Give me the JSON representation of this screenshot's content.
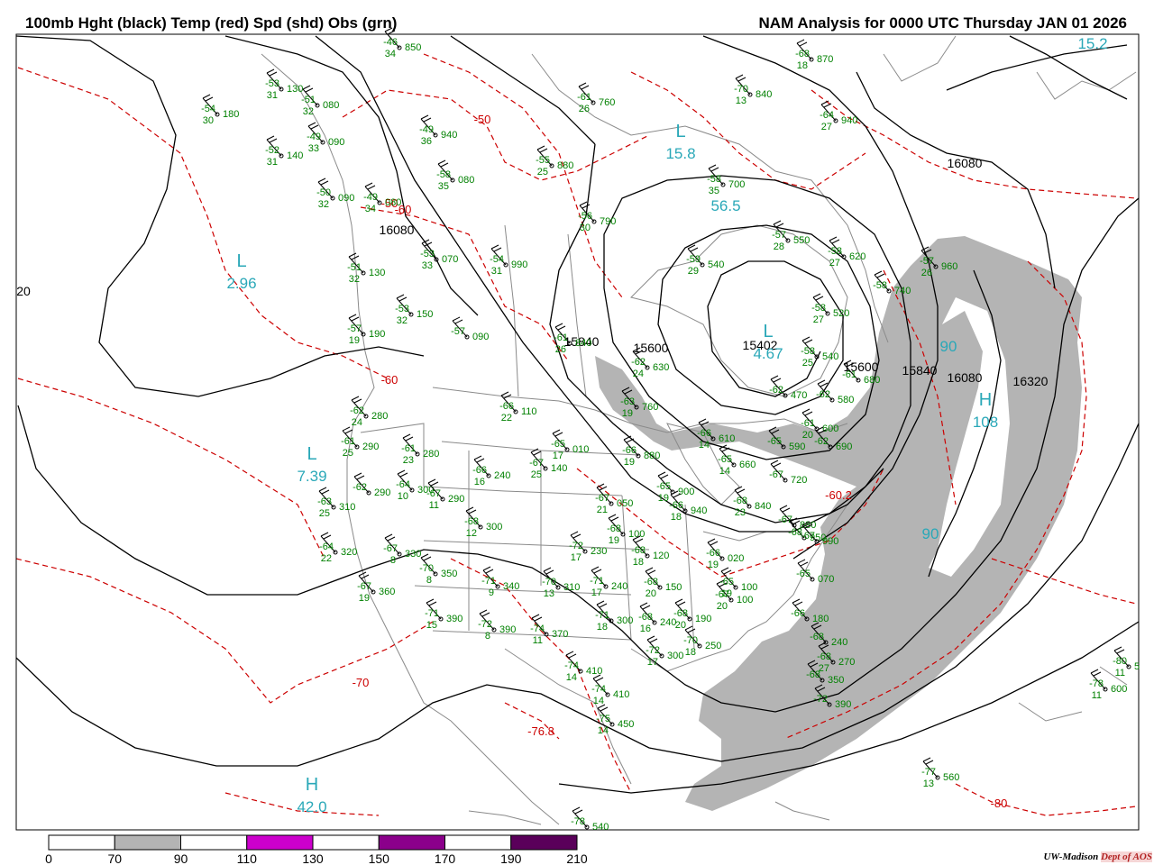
{
  "header": {
    "left_title": "100mb Hght (black) Temp (red) Spd (shd) Obs (grn)",
    "right_title": "NAM Analysis for 0000 UTC Thursday  JAN 01 2026"
  },
  "credit": {
    "org": "UW-Madison",
    "dept": "Dept of AOS"
  },
  "colors": {
    "height_contours": "#000000",
    "temperature_contours": "#cc0000",
    "speed_shading_70_90": "#b4b4b4",
    "observations": "#008000",
    "centers": "#2aa8b8",
    "borders": "#888888"
  },
  "colorbar": {
    "ticks": [
      "0",
      "70",
      "90",
      "110",
      "130",
      "150",
      "170",
      "190",
      "210"
    ],
    "fills": [
      "#ffffff",
      "#b4b4b4",
      "#ffffff",
      "#cc00cc",
      "#ffffff",
      "#8b008b",
      "#ffffff",
      "#5a005a"
    ]
  },
  "centers": [
    {
      "letter": "L",
      "value": "2.96"
    },
    {
      "letter": "L",
      "value": "7.39"
    },
    {
      "letter": "H",
      "value": "42.0"
    },
    {
      "letter": "L",
      "value": "15.8"
    },
    {
      "letter": "",
      "value": "56.5"
    },
    {
      "letter": "L",
      "value": "4.67"
    },
    {
      "letter": "H",
      "value": "108"
    },
    {
      "letter": "",
      "value": "90"
    },
    {
      "letter": "",
      "value": "90"
    },
    {
      "letter": "",
      "value": "15.2"
    }
  ],
  "height_labels": [
    "16080",
    "16080",
    "16080",
    "15840",
    "15840",
    "15600",
    "15600",
    "15402",
    "16320",
    "20"
  ],
  "temp_labels": [
    "-50",
    "-60",
    "-60",
    "-70",
    "-76.8",
    "-80",
    "-60.2",
    "-50"
  ],
  "observations": [
    {
      "temp": "-46",
      "dew": "34",
      "hgt": "850"
    },
    {
      "temp": "-53",
      "dew": "31",
      "hgt": "130"
    },
    {
      "temp": "-51",
      "dew": "32",
      "hgt": "080"
    },
    {
      "temp": "-54",
      "dew": "30",
      "hgt": "180"
    },
    {
      "temp": "-49",
      "dew": "33",
      "hgt": "090"
    },
    {
      "temp": "-52",
      "dew": "31",
      "hgt": "140"
    },
    {
      "temp": "-49",
      "dew": "36",
      "hgt": "940"
    },
    {
      "temp": "-50",
      "dew": "32",
      "hgt": "090"
    },
    {
      "temp": "-49",
      "dew": "34",
      "hgt": "080"
    },
    {
      "temp": "-51",
      "dew": "32",
      "hgt": "130"
    },
    {
      "temp": "-53",
      "dew": "32",
      "hgt": "150"
    },
    {
      "temp": "-57",
      "dew": "",
      "hgt": "090"
    },
    {
      "temp": "-57",
      "dew": "19",
      "hgt": "190"
    },
    {
      "temp": "-62",
      "dew": "24",
      "hgt": "280"
    },
    {
      "temp": "-61",
      "dew": "25",
      "hgt": "290"
    },
    {
      "temp": "-61",
      "dew": "23",
      "hgt": "280"
    },
    {
      "temp": "-62",
      "dew": "",
      "hgt": "290"
    },
    {
      "temp": "-64",
      "dew": "10",
      "hgt": "300"
    },
    {
      "temp": "-63",
      "dew": "25",
      "hgt": "310"
    },
    {
      "temp": "-64",
      "dew": "22",
      "hgt": "320"
    },
    {
      "temp": "-67",
      "dew": "8",
      "hgt": "330"
    },
    {
      "temp": "-67",
      "dew": "19",
      "hgt": "360"
    },
    {
      "temp": "-70",
      "dew": "8",
      "hgt": "350"
    },
    {
      "temp": "-71",
      "dew": "15",
      "hgt": "390"
    },
    {
      "temp": "-66",
      "dew": "16",
      "hgt": "240"
    },
    {
      "temp": "-67",
      "dew": "11",
      "hgt": "290"
    },
    {
      "temp": "-68",
      "dew": "12",
      "hgt": "300"
    },
    {
      "temp": "-71",
      "dew": "9",
      "hgt": "340"
    },
    {
      "temp": "-70",
      "dew": "13",
      "hgt": "310"
    },
    {
      "temp": "-72",
      "dew": "8",
      "hgt": "390"
    },
    {
      "temp": "-74",
      "dew": "11",
      "hgt": "370"
    },
    {
      "temp": "-74",
      "dew": "14",
      "hgt": "410"
    },
    {
      "temp": "-74",
      "dew": "14",
      "hgt": "410"
    },
    {
      "temp": "-75",
      "dew": "14",
      "hgt": "450"
    },
    {
      "temp": "-78",
      "dew": "",
      "hgt": "540"
    },
    {
      "temp": "-72",
      "dew": "17",
      "hgt": "230"
    },
    {
      "temp": "-71",
      "dew": "17",
      "hgt": "240"
    },
    {
      "temp": "-71",
      "dew": "18",
      "hgt": "300"
    },
    {
      "temp": "-66",
      "dew": "22",
      "hgt": "110"
    },
    {
      "temp": "-67",
      "dew": "25",
      "hgt": "140"
    },
    {
      "temp": "-65",
      "dew": "17",
      "hgt": "010"
    },
    {
      "temp": "-67",
      "dew": "21",
      "hgt": "050"
    },
    {
      "temp": "-68",
      "dew": "19",
      "hgt": "100"
    },
    {
      "temp": "-68",
      "dew": "18",
      "hgt": "120"
    },
    {
      "temp": "-68",
      "dew": "20",
      "hgt": "150"
    },
    {
      "temp": "-68",
      "dew": "20",
      "hgt": "190"
    },
    {
      "temp": "-68",
      "dew": "16",
      "hgt": "240"
    },
    {
      "temp": "-70",
      "dew": "18",
      "hgt": "250"
    },
    {
      "temp": "-72",
      "dew": "17",
      "hgt": "300"
    },
    {
      "temp": "-55",
      "dew": "25",
      "hgt": "880"
    },
    {
      "temp": "-56",
      "dew": "30",
      "hgt": "790"
    },
    {
      "temp": "-54",
      "dew": "31",
      "hgt": "990"
    },
    {
      "temp": "-53",
      "dew": "33",
      "hgt": "070"
    },
    {
      "temp": "-58",
      "dew": "35",
      "hgt": "080"
    },
    {
      "temp": "-61",
      "dew": "26",
      "hgt": "760"
    },
    {
      "temp": "-61",
      "dew": "26",
      "hgt": "840"
    },
    {
      "temp": "-62",
      "dew": "24",
      "hgt": "630"
    },
    {
      "temp": "-63",
      "dew": "19",
      "hgt": "760"
    },
    {
      "temp": "-66",
      "dew": "19",
      "hgt": "880"
    },
    {
      "temp": "-65",
      "dew": "19",
      "hgt": "900"
    },
    {
      "temp": "-66",
      "dew": "18",
      "hgt": "940"
    },
    {
      "temp": "-68",
      "dew": "23",
      "hgt": "840"
    },
    {
      "temp": "-66",
      "dew": "19",
      "hgt": "020"
    },
    {
      "temp": "-67",
      "dew": "20",
      "hgt": "100"
    },
    {
      "temp": "-65",
      "dew": "19",
      "hgt": "100"
    },
    {
      "temp": "-66",
      "dew": "14",
      "hgt": "610"
    },
    {
      "temp": "-65",
      "dew": "14",
      "hgt": "660"
    },
    {
      "temp": "-65",
      "dew": "",
      "hgt": "590"
    },
    {
      "temp": "-67",
      "dew": "",
      "hgt": "720"
    },
    {
      "temp": "-67",
      "dew": "",
      "hgt": "880"
    },
    {
      "temp": "-68",
      "dew": "",
      "hgt": "950"
    },
    {
      "temp": "-67",
      "dew": "",
      "hgt": "990"
    },
    {
      "temp": "-65",
      "dew": "",
      "hgt": "070"
    },
    {
      "temp": "-66",
      "dew": "",
      "hgt": "180"
    },
    {
      "temp": "-68",
      "dew": "",
      "hgt": "240"
    },
    {
      "temp": "-68",
      "dew": "27",
      "hgt": "270"
    },
    {
      "temp": "-68",
      "dew": "",
      "hgt": "350"
    },
    {
      "temp": "-72",
      "dew": "",
      "hgt": "390"
    },
    {
      "temp": "-62",
      "dew": "",
      "hgt": "470"
    },
    {
      "temp": "-61",
      "dew": "20",
      "hgt": "600"
    },
    {
      "temp": "-62",
      "dew": "",
      "hgt": "690"
    },
    {
      "temp": "-62",
      "dew": "",
      "hgt": "580"
    },
    {
      "temp": "-61",
      "dew": "",
      "hgt": "680"
    },
    {
      "temp": "-58",
      "dew": "25",
      "hgt": "540"
    },
    {
      "temp": "-58",
      "dew": "27",
      "hgt": "520"
    },
    {
      "temp": "-58",
      "dew": "",
      "hgt": "740"
    },
    {
      "temp": "-58",
      "dew": "27",
      "hgt": "620"
    },
    {
      "temp": "-57",
      "dew": "28",
      "hgt": "550"
    },
    {
      "temp": "-59",
      "dew": "29",
      "hgt": "540"
    },
    {
      "temp": "-58",
      "dew": "35",
      "hgt": "700"
    },
    {
      "temp": "-57",
      "dew": "26",
      "hgt": "960"
    },
    {
      "temp": "-70",
      "dew": "13",
      "hgt": "840"
    },
    {
      "temp": "-68",
      "dew": "18",
      "hgt": "870"
    },
    {
      "temp": "-64",
      "dew": "27",
      "hgt": "940"
    },
    {
      "temp": "-77",
      "dew": "13",
      "hgt": "560"
    },
    {
      "temp": "-78",
      "dew": "11",
      "hgt": "600"
    },
    {
      "temp": "-80",
      "dew": "11",
      "hgt": "5"
    }
  ]
}
